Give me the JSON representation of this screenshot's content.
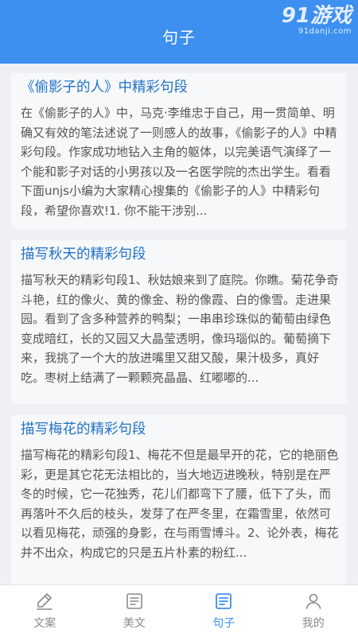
{
  "header": {
    "title": "句子"
  },
  "logo": {
    "mark": "91游戏",
    "domain": "91danji.com"
  },
  "articles": [
    {
      "title": "《偷影子的人》中精彩句段",
      "snippet": "在《偷影子的人》中，马克·李维忠于自己，用一贯简单、明确又有效的笔法述说了一则感人的故事，《偷影子的人》中精彩句段。作家成功地钻入主角的躯体，以完美语气演绎了一个能和影子对话的小男孩以及一名医学院的杰出学生。看看下面unjs小编为大家精心搜集的《偷影子的人》中精彩句段，希望你喜欢!1. 你不能干涉别..."
    },
    {
      "title": "描写秋天的精彩句段",
      "snippet": "描写秋天的精彩句段1、秋姑娘来到了庭院。你瞧。菊花争奇斗艳，红的像火、黄的像金、粉的像霞、白的像雪。走进果园。看到了含多种营养的鸭梨；一串串珍珠似的葡萄由绿色变成暗红，长的又园又大晶莹透明，像玛瑙似的。葡萄摘下来，我挑了一个大的放进嘴里又甜又酸，果汁极多，真好吃。枣树上结满了一颗颗亮晶晶、红嘟嘟的..."
    },
    {
      "title": "描写梅花的精彩句段",
      "snippet": "描写梅花的精彩句段1、梅花不但是最早开的花，它的艳丽色彩，更是其它花无法相比的，当大地迈进晚秋，特别是在严冬的时候，它一花独秀，花儿们都弯下了腰，低下了头，而再落叶不久后的枝头，发芽了在严冬里，在霜雪里，依然可以看见梅花，顽强的身影，在与雨雪博斗。2、论外表，梅花并不出众，构成它的只是五片朴素的粉红..."
    }
  ],
  "tabs": [
    {
      "label": "文案",
      "icon": "pen-icon"
    },
    {
      "label": "美文",
      "icon": "document-icon"
    },
    {
      "label": "句子",
      "icon": "document-icon"
    },
    {
      "label": "我的",
      "icon": "user-icon"
    }
  ],
  "active_tab": "句子",
  "colors": {
    "accent": "#3d8ff0",
    "title": "#2273c8",
    "text": "#555555"
  }
}
